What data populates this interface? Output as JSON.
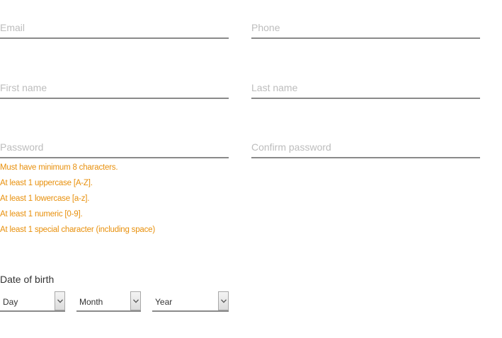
{
  "form": {
    "email": {
      "placeholder": "Email",
      "value": ""
    },
    "phone": {
      "placeholder": "Phone",
      "value": ""
    },
    "first_name": {
      "placeholder": "First name",
      "value": ""
    },
    "last_name": {
      "placeholder": "Last name",
      "value": ""
    },
    "password": {
      "placeholder": "Password",
      "value": ""
    },
    "confirm_password": {
      "placeholder": "Confirm password",
      "value": ""
    }
  },
  "password_rules": {
    "color": "#e8900c",
    "items": [
      "Must have minimum 8 characters.",
      "At least 1 uppercase [A-Z].",
      "At least 1 lowercase [a-z].",
      "At least 1 numeric [0-9].",
      "At least 1 special character (including space)"
    ]
  },
  "date_of_birth": {
    "label": "Date of birth",
    "day": {
      "selected": "Day",
      "icon": "chevron-down-icon"
    },
    "month": {
      "selected": "Month",
      "icon": "chevron-down-icon"
    },
    "year": {
      "selected": "Year",
      "icon": "chevron-down-icon"
    }
  }
}
